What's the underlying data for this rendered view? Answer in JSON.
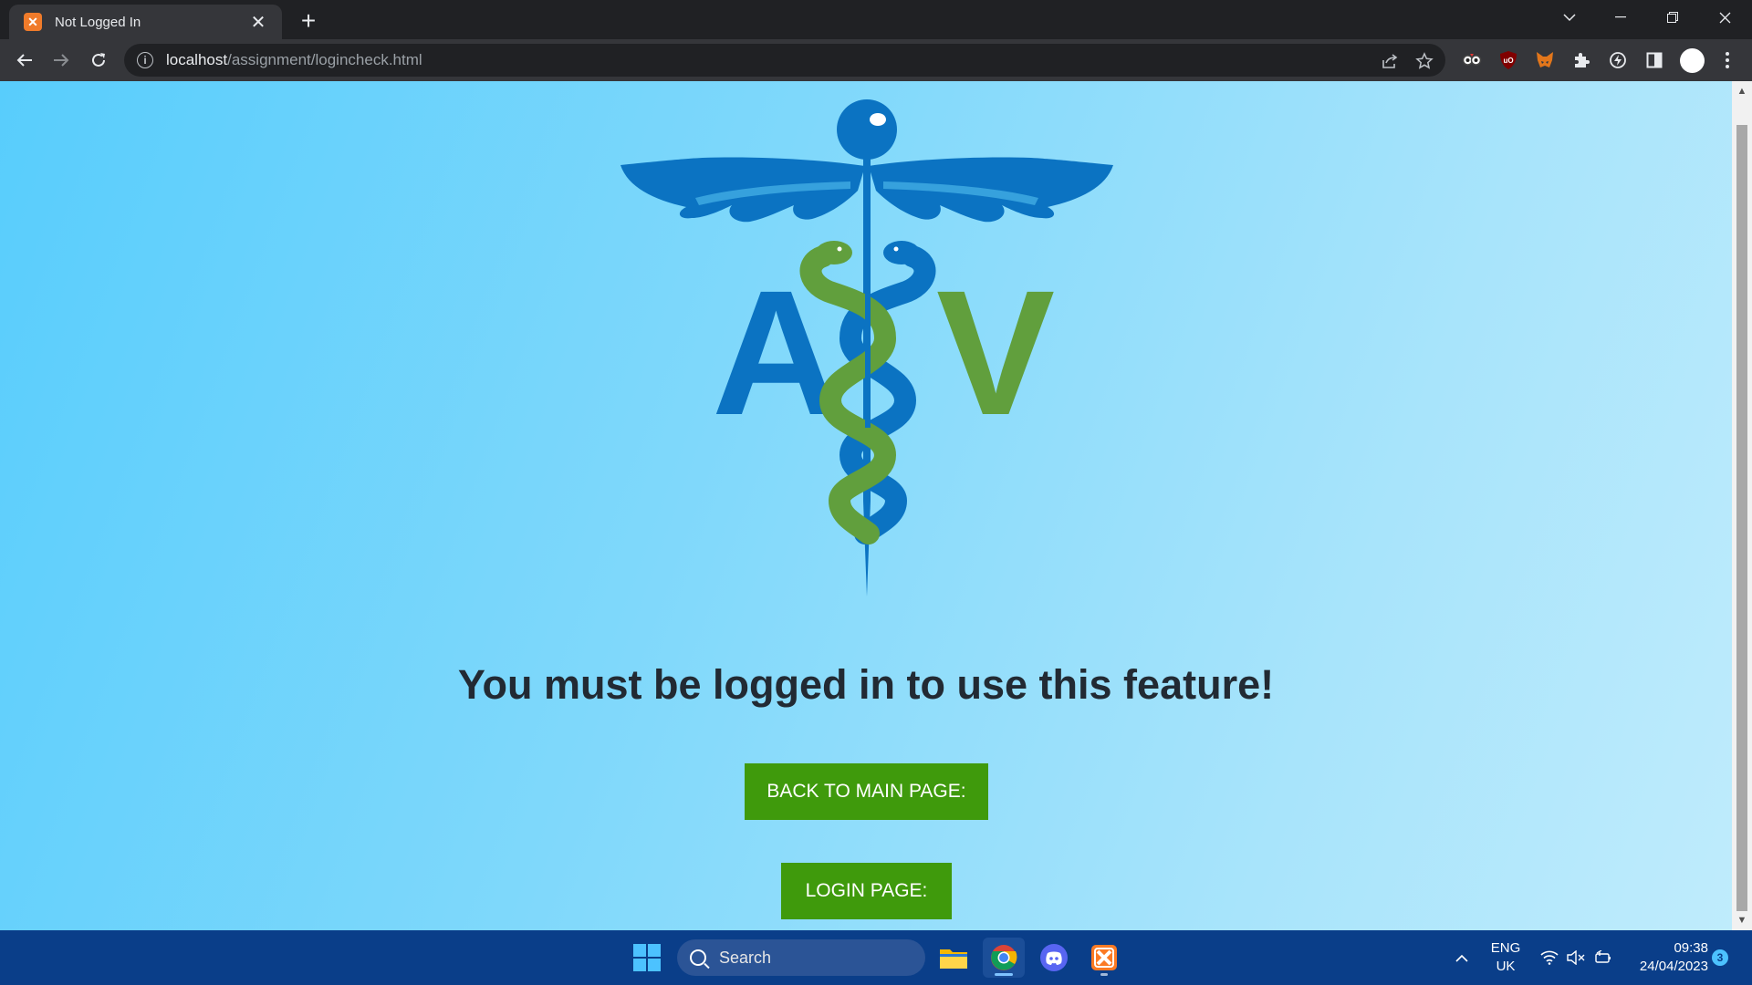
{
  "browser": {
    "tab_title": "Not Logged In",
    "tab_favicon": "xampp-icon",
    "url_host": "localhost",
    "url_path": "/assignment/logincheck.html"
  },
  "page": {
    "logo": {
      "letter_left": "A",
      "letter_right": "V",
      "emblem": "caduceus",
      "color_blue": "#0b73c2",
      "color_green": "#619f3d"
    },
    "message": "You must be logged in to use this feature!",
    "btn_main": "BACK TO MAIN PAGE:",
    "btn_login": "LOGIN PAGE:",
    "button_color": "#3f9a0c",
    "text_color": "#222a33"
  },
  "taskbar": {
    "search_placeholder": "Search",
    "lang_line1": "ENG",
    "lang_line2": "UK",
    "time": "09:38",
    "date": "24/04/2023",
    "notification_count": "3"
  }
}
